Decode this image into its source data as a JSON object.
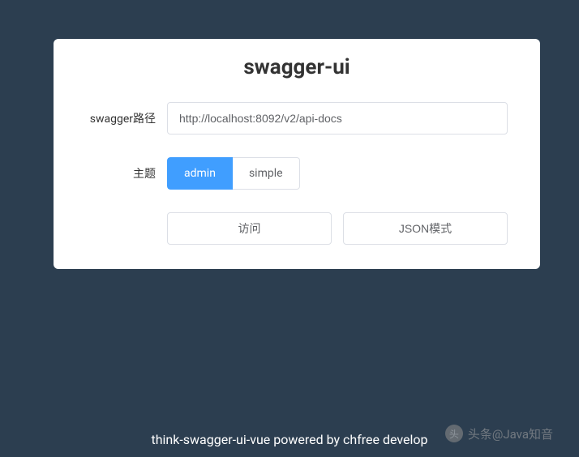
{
  "title": "swagger-ui",
  "form": {
    "path_label": "swagger路径",
    "path_value": "http://localhost:8092/v2/api-docs",
    "theme_label": "主题",
    "theme_options": {
      "admin": "admin",
      "simple": "simple"
    },
    "visit_button": "访问",
    "json_button": "JSON模式"
  },
  "footer": "think-swagger-ui-vue powered by chfree develop",
  "watermark": "头条@Java知音"
}
